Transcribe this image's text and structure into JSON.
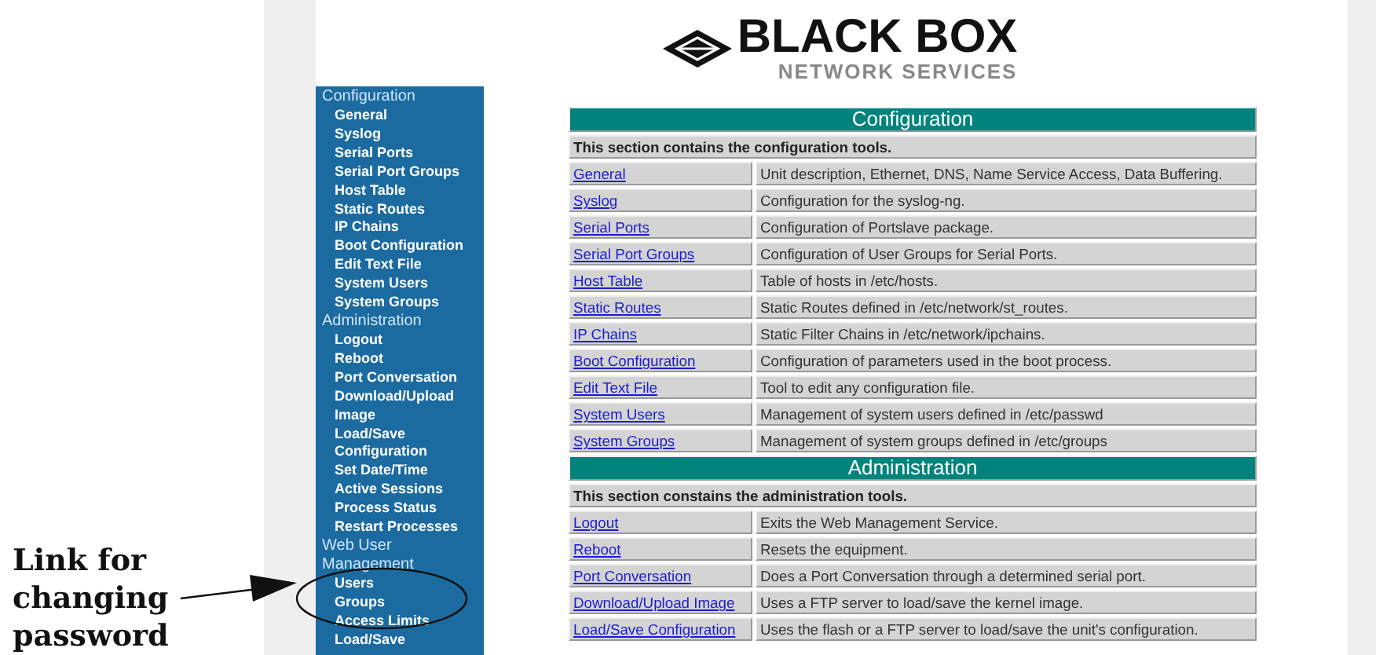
{
  "annotation": {
    "text": "Link for changing password"
  },
  "logo": {
    "brand": "BLACK BOX",
    "tagline": "NETWORK SERVICES"
  },
  "sidebar": {
    "items": [
      {
        "kind": "header",
        "label": "Configuration"
      },
      {
        "kind": "link",
        "label": "General"
      },
      {
        "kind": "link",
        "label": "Syslog"
      },
      {
        "kind": "link",
        "label": "Serial Ports"
      },
      {
        "kind": "link",
        "label": "Serial Port Groups"
      },
      {
        "kind": "link",
        "label": "Host Table"
      },
      {
        "kind": "link",
        "label": "Static Routes"
      },
      {
        "kind": "link",
        "label": "IP Chains"
      },
      {
        "kind": "link",
        "label": "Boot Configuration"
      },
      {
        "kind": "link",
        "label": "Edit Text File"
      },
      {
        "kind": "link",
        "label": "System Users"
      },
      {
        "kind": "link",
        "label": "System Groups"
      },
      {
        "kind": "header",
        "label": "Administration"
      },
      {
        "kind": "link",
        "label": "Logout"
      },
      {
        "kind": "link",
        "label": "Reboot"
      },
      {
        "kind": "link",
        "label": "Port Conversation"
      },
      {
        "kind": "link",
        "label": "Download/Upload Image"
      },
      {
        "kind": "link",
        "label": "Load/Save Configuration"
      },
      {
        "kind": "link",
        "label": "Set Date/Time"
      },
      {
        "kind": "link",
        "label": "Active Sessions"
      },
      {
        "kind": "link",
        "label": "Process Status"
      },
      {
        "kind": "link",
        "label": "Restart Processes"
      },
      {
        "kind": "header",
        "label": "Web User Management"
      },
      {
        "kind": "link",
        "label": "Users"
      },
      {
        "kind": "link",
        "label": "Groups"
      },
      {
        "kind": "link",
        "label": "Access Limits"
      },
      {
        "kind": "link",
        "label": "Load/Save"
      }
    ]
  },
  "sections": [
    {
      "title": "Configuration",
      "intro": "This section contains the configuration tools.",
      "rows": [
        {
          "link": "General",
          "description": "Unit description, Ethernet, DNS, Name Service Access, Data Buffering."
        },
        {
          "link": "Syslog",
          "description": "Configuration for the syslog-ng."
        },
        {
          "link": "Serial Ports",
          "description": "Configuration of Portslave package."
        },
        {
          "link": "Serial Port Groups",
          "description": "Configuration of User Groups for Serial Ports."
        },
        {
          "link": "Host Table",
          "description": "Table of hosts in /etc/hosts."
        },
        {
          "link": "Static Routes",
          "description": "Static Routes defined in /etc/network/st_routes."
        },
        {
          "link": "IP Chains",
          "description": "Static Filter Chains in /etc/network/ipchains."
        },
        {
          "link": "Boot Configuration",
          "description": "Configuration of parameters used in the boot process."
        },
        {
          "link": "Edit Text File",
          "description": "Tool to edit any configuration file."
        },
        {
          "link": "System Users",
          "description": "Management of system users defined in /etc/passwd"
        },
        {
          "link": "System Groups",
          "description": "Management of system groups defined in /etc/groups"
        }
      ]
    },
    {
      "title": "Administration",
      "intro": "This section constains the administration tools.",
      "rows": [
        {
          "link": "Logout",
          "description": "Exits the Web Management Service."
        },
        {
          "link": "Reboot",
          "description": "Resets the equipment."
        },
        {
          "link": "Port Conversation",
          "description": "Does a Port Conversation through a determined serial port."
        },
        {
          "link": "Download/Upload Image",
          "description": "Uses a FTP server to load/save the kernel image."
        },
        {
          "link": "Load/Save Configuration",
          "description": "Uses the flash or a FTP server to load/save the unit's configuration."
        }
      ]
    }
  ]
}
